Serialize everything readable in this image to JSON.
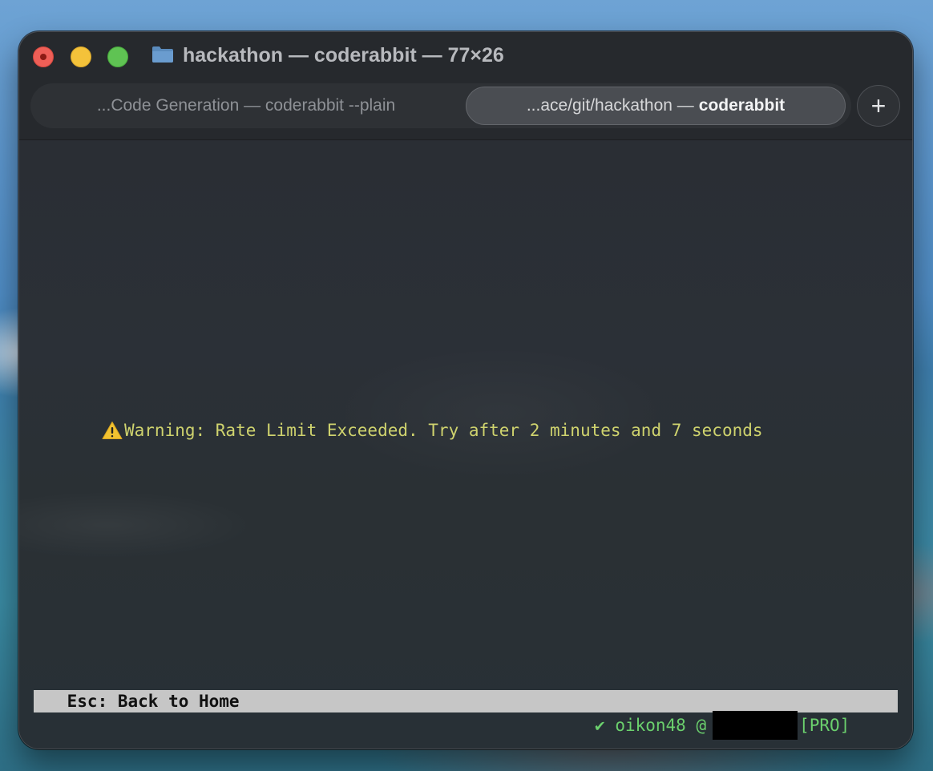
{
  "window": {
    "title": "hackathon — coderabbit — 77×26"
  },
  "tabs": [
    {
      "label": "...Code Generation — coderabbit --plain",
      "active": false
    },
    {
      "label_prefix": "...ace/git/hackathon —",
      "label_bold": "coderabbit",
      "active": true
    }
  ],
  "new_tab_symbol": "+",
  "terminal": {
    "warning_text": "Warning: Rate Limit Exceeded. Try after 2 minutes and 7 seconds",
    "status_bar_text": " Esc: Back to Home",
    "user": {
      "check": "✔",
      "name": "oikon48 @",
      "plan": "[PRO]"
    }
  },
  "colors": {
    "warning": "#cfd36e",
    "user": "#6bd06d",
    "status_bar_bg": "#c6c6c6",
    "close": "#ee5f57",
    "minimize": "#f4c23a",
    "maximize": "#5fc353"
  },
  "icons": [
    "folder-icon",
    "warning-icon",
    "plus-icon"
  ]
}
